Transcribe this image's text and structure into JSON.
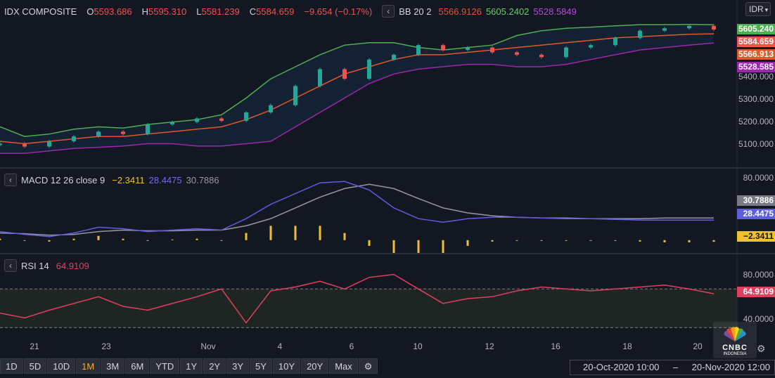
{
  "main": {
    "symbol": "IDX COMPOSITE",
    "o_label": "O",
    "o_value": "5593.686",
    "h_label": "H",
    "h_value": "5595.310",
    "l_label": "L",
    "l_value": "5581.239",
    "c_label": "C",
    "c_value": "5584.659",
    "change": "−9.654 (−0.17%)",
    "bb_label": "BB 20 2",
    "bb_basis": "5566.9126",
    "bb_upper": "5605.2402",
    "bb_lower": "5528.5849",
    "currency": "IDR",
    "axis_ticks": [
      "5400.000",
      "5300.000",
      "5200.000",
      "5100.000"
    ],
    "axis_boxes": [
      {
        "text": "5605.240",
        "color": "#4caf50"
      },
      {
        "text": "5584.659",
        "color": "#ef5350"
      },
      {
        "text": "5566.913",
        "color": "#e0582a"
      },
      {
        "text": "5528.585",
        "color": "#9c27b0"
      }
    ]
  },
  "macd": {
    "label": "MACD 12 26 close 9",
    "hist_value": "−2.3411",
    "macd_value": "28.4475",
    "signal_value": "30.7886",
    "axis_ticks": [
      "80.0000"
    ],
    "axis_boxes": [
      {
        "text": "30.7886",
        "color": "#787b86"
      },
      {
        "text": "28.4475",
        "color": "#5b5fe0"
      },
      {
        "text": "−2.3411",
        "color": "#f0c030"
      }
    ]
  },
  "rsi": {
    "label": "RSI 14",
    "value": "64.9109",
    "axis_ticks": [
      "80.0000",
      "40.0000"
    ],
    "axis_boxes": [
      {
        "text": "64.9109",
        "color": "#e04060"
      }
    ]
  },
  "xaxis": [
    "21",
    "23",
    "Nov",
    "4",
    "6",
    "10",
    "12",
    "16",
    "18",
    "20"
  ],
  "toolbar": [
    "1D",
    "5D",
    "10D",
    "1M",
    "3M",
    "6M",
    "YTD",
    "1Y",
    "2Y",
    "3Y",
    "5Y",
    "10Y",
    "20Y",
    "Max"
  ],
  "toolbar_active": "1M",
  "range": {
    "start": "20-Oct-2020 10:00",
    "end": "20-Nov-2020 12:00"
  },
  "logo": {
    "name": "CNBC",
    "sub": "INDONESIA"
  },
  "chart_data": {
    "type": "line",
    "x": [
      "21",
      "23",
      "Nov",
      "4",
      "6",
      "10",
      "12",
      "16",
      "18",
      "20"
    ],
    "price": {
      "ylim": [
        5050,
        5620
      ],
      "close": [
        5110,
        5098,
        5120,
        5140,
        5160,
        5150,
        5190,
        5200,
        5215,
        5205,
        5240,
        5270,
        5350,
        5420,
        5380,
        5460,
        5480,
        5520,
        5500,
        5510,
        5490,
        5480,
        5470,
        5510,
        5520,
        5550,
        5580,
        5590,
        5600,
        5585
      ],
      "bb_upper": [
        5180,
        5140,
        5150,
        5170,
        5180,
        5175,
        5190,
        5200,
        5210,
        5230,
        5300,
        5380,
        5430,
        5480,
        5520,
        5530,
        5530,
        5510,
        5500,
        5510,
        5520,
        5560,
        5580,
        5590,
        5595,
        5600,
        5605,
        5605,
        5606,
        5605
      ],
      "bb_basis": [
        5120,
        5110,
        5120,
        5130,
        5140,
        5140,
        5150,
        5160,
        5170,
        5180,
        5210,
        5250,
        5300,
        5350,
        5400,
        5430,
        5460,
        5480,
        5480,
        5490,
        5500,
        5510,
        5520,
        5530,
        5540,
        5550,
        5555,
        5560,
        5565,
        5567
      ],
      "bb_lower": [
        5070,
        5070,
        5080,
        5090,
        5095,
        5100,
        5110,
        5110,
        5100,
        5100,
        5110,
        5120,
        5180,
        5240,
        5300,
        5360,
        5400,
        5420,
        5430,
        5440,
        5440,
        5430,
        5430,
        5440,
        5460,
        5480,
        5500,
        5510,
        5520,
        5529
      ]
    },
    "macd": {
      "ylim": [
        -10,
        90
      ],
      "macd": [
        12,
        8,
        5,
        10,
        18,
        16,
        12,
        14,
        16,
        14,
        30,
        50,
        65,
        80,
        82,
        70,
        45,
        30,
        25,
        30,
        32,
        32,
        31,
        30,
        30,
        29,
        28,
        28,
        28,
        28
      ],
      "signal": [
        10,
        9,
        7,
        8,
        12,
        14,
        13,
        13,
        14,
        14,
        20,
        30,
        45,
        60,
        72,
        78,
        72,
        58,
        45,
        38,
        34,
        32,
        31,
        31,
        30,
        30,
        30,
        31,
        31,
        31
      ],
      "hist": [
        2,
        -1,
        -2,
        2,
        6,
        2,
        -1,
        1,
        2,
        0,
        10,
        20,
        20,
        20,
        10,
        -8,
        -27,
        -28,
        -20,
        -8,
        -2,
        0,
        0,
        -1,
        0,
        -1,
        -2,
        -3,
        -3,
        -2.3
      ]
    },
    "rsi": {
      "ylim": [
        20,
        100
      ],
      "rsi": [
        45,
        40,
        48,
        55,
        62,
        52,
        48,
        55,
        62,
        70,
        35,
        68,
        72,
        78,
        70,
        82,
        85,
        70,
        55,
        60,
        62,
        68,
        72,
        70,
        68,
        70,
        72,
        74,
        70,
        65
      ],
      "upper_band": 70,
      "lower_band": 30
    }
  }
}
